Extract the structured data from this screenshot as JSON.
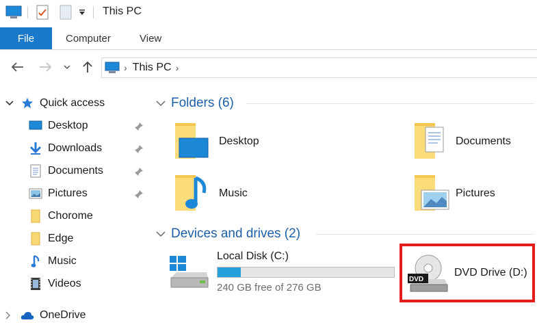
{
  "window": {
    "title": "This PC"
  },
  "ribbon": {
    "tabs": [
      "File",
      "Computer",
      "View"
    ]
  },
  "address": {
    "location": "This PC"
  },
  "sidebar": {
    "quick_access": "Quick access",
    "items": [
      {
        "label": "Desktop",
        "icon": "desktop-icon",
        "pinned": true
      },
      {
        "label": "Downloads",
        "icon": "download-arrow-icon",
        "pinned": true
      },
      {
        "label": "Documents",
        "icon": "documents-icon",
        "pinned": true
      },
      {
        "label": "Pictures",
        "icon": "pictures-icon",
        "pinned": true
      },
      {
        "label": "Chorome",
        "icon": "folder-icon",
        "pinned": false
      },
      {
        "label": "Edge",
        "icon": "folder-icon",
        "pinned": false
      },
      {
        "label": "Music",
        "icon": "music-note-icon",
        "pinned": false
      },
      {
        "label": "Videos",
        "icon": "videos-icon",
        "pinned": false
      }
    ],
    "onedrive": "OneDrive"
  },
  "folders": {
    "heading": "Folders (6)",
    "items": [
      {
        "label": "Desktop",
        "icon": "desktop-folder-icon"
      },
      {
        "label": "Documents",
        "icon": "documents-folder-icon"
      },
      {
        "label": "Music",
        "icon": "music-folder-icon"
      },
      {
        "label": "Pictures",
        "icon": "pictures-folder-icon"
      }
    ]
  },
  "devices": {
    "heading": "Devices and drives (2)",
    "local_disk": {
      "label": "Local Disk (C:)",
      "free_text": "240 GB free of 276 GB",
      "used_fraction": 0.13
    },
    "dvd": {
      "label": "DVD Drive (D:)",
      "badge": "DVD"
    }
  },
  "colors": {
    "accent": "#1979ca",
    "heading": "#1d5fa8",
    "highlight": "#e31c1c",
    "bar_fill": "#26a0da"
  }
}
